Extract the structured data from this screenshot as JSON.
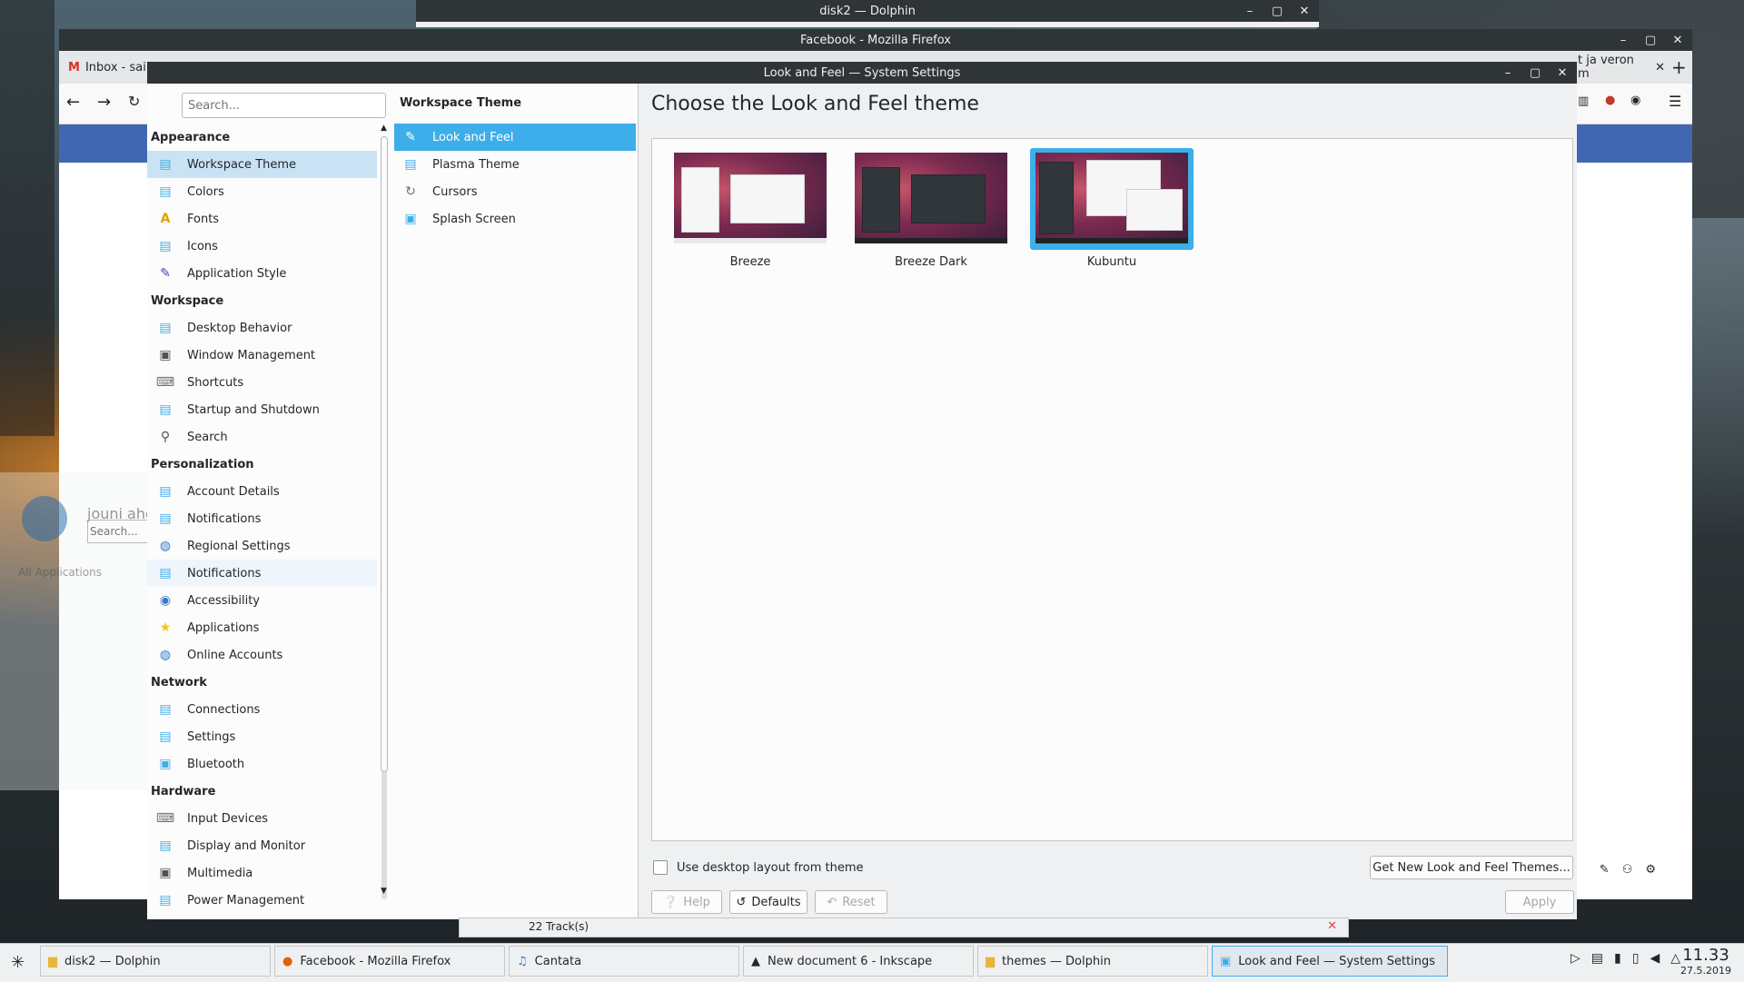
{
  "desktop": {
    "dolphin_title": "disk2 — Dolphin",
    "firefox_title": "Facebook - Mozilla Firefox",
    "firefox_tab_1": "Inbox - sair",
    "firefox_tab_right": "t ja veron m",
    "kde_menu": {
      "user": "jouni ahokas",
      "search_placeholder": "Search...",
      "all_apps": "All Applications"
    },
    "cantata_status": "22 Track(s)"
  },
  "settings": {
    "title": "Look and Feel — System Settings",
    "search_placeholder": "Search...",
    "sidebar": {
      "cat_appearance": "Appearance",
      "workspace_theme": "Workspace Theme",
      "colors": "Colors",
      "fonts": "Fonts",
      "icons": "Icons",
      "application_style": "Application Style",
      "cat_workspace": "Workspace",
      "desktop_behavior": "Desktop Behavior",
      "window_management": "Window Management",
      "shortcuts": "Shortcuts",
      "startup_shutdown": "Startup and Shutdown",
      "search": "Search",
      "cat_personalization": "Personalization",
      "account_details": "Account Details",
      "notifications_a": "Notifications",
      "regional_settings": "Regional Settings",
      "notifications_b": "Notifications",
      "accessibility": "Accessibility",
      "applications": "Applications",
      "online_accounts": "Online Accounts",
      "cat_network": "Network",
      "connections": "Connections",
      "net_settings": "Settings",
      "bluetooth": "Bluetooth",
      "cat_hardware": "Hardware",
      "input_devices": "Input Devices",
      "display_monitor": "Display and Monitor",
      "multimedia": "Multimedia",
      "power_management": "Power Management"
    },
    "middle": {
      "header": "Workspace Theme",
      "look_and_feel": "Look and Feel",
      "plasma_theme": "Plasma Theme",
      "cursors": "Cursors",
      "splash_screen": "Splash Screen"
    },
    "main": {
      "title": "Choose the Look and Feel theme",
      "themes": {
        "breeze": "Breeze",
        "breeze_dark": "Breeze Dark",
        "kubuntu": "Kubuntu"
      },
      "use_layout": "Use desktop layout from theme",
      "get_new": "Get New Look and Feel Themes...",
      "help": "Help",
      "defaults": "Defaults",
      "reset": "Reset",
      "apply": "Apply"
    }
  },
  "taskbar": {
    "t1": "disk2 — Dolphin",
    "t2": "Facebook - Mozilla Firefox",
    "t3": "Cantata",
    "t4": "New document 6 - Inkscape",
    "t5": "themes — Dolphin",
    "t6": "Look and Feel — System Settings",
    "time": "11.33",
    "date": "27.5.2019"
  },
  "colors": {
    "accent": "#3daee9",
    "selection": "#c9e3f5"
  }
}
